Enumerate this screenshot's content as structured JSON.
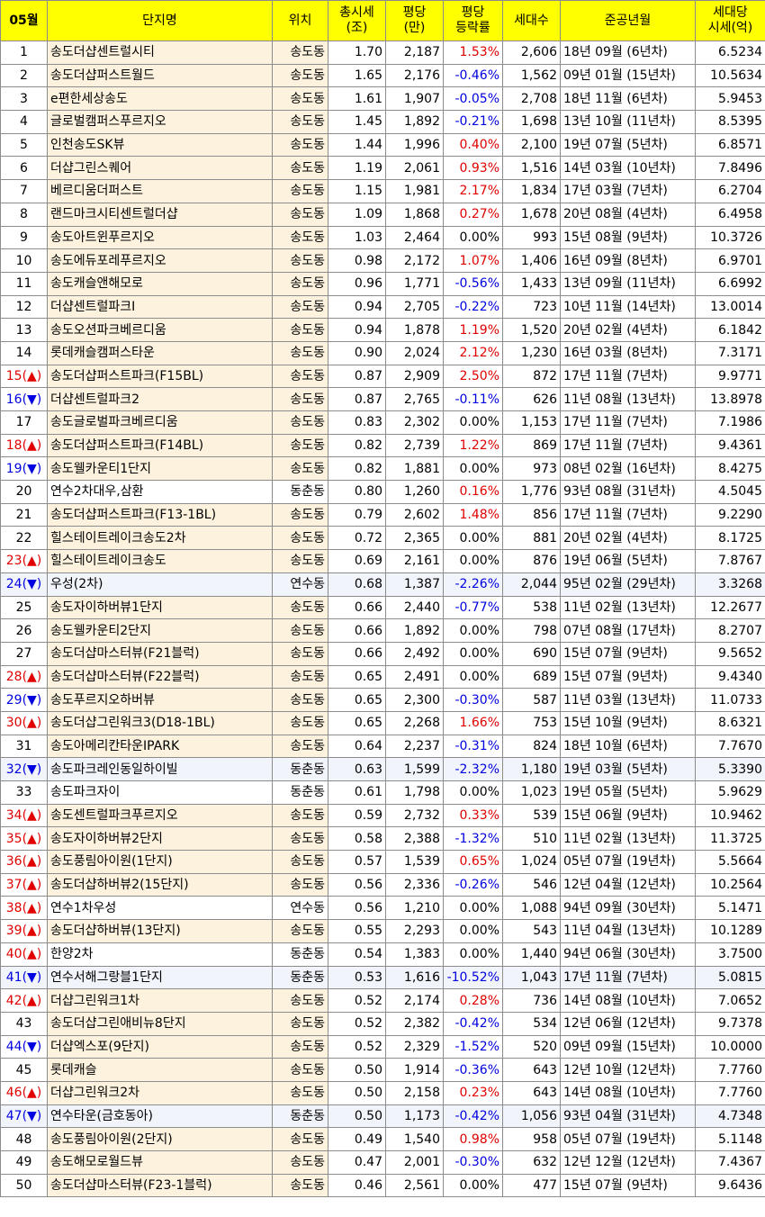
{
  "headers": {
    "month": "05월",
    "name": "단지명",
    "location": "위치",
    "total": "총시세\n(조)",
    "per_pyeong": "평당\n(만)",
    "change": "평당\n등락률",
    "households": "세대수",
    "completion": "준공년월",
    "per_household": "세대당\n시세(억)"
  },
  "colors": {
    "up": "#e00000",
    "down": "#0000e0",
    "header_bg": "#ffff00",
    "row_tint": "#fdf2dd"
  },
  "rows": [
    {
      "rank": "1",
      "name": "송도더샵센트럴시티",
      "loc": "송도동",
      "total": "1.70",
      "pp": "2,187",
      "chg": "1.53%",
      "hh": "2,606",
      "year": "18년 09월 (6년차)",
      "phh": "6.5234"
    },
    {
      "rank": "2",
      "name": "송도더샵퍼스트월드",
      "loc": "송도동",
      "total": "1.65",
      "pp": "2,176",
      "chg": "-0.46%",
      "hh": "1,562",
      "year": "09년 01월 (15년차)",
      "phh": "10.5634"
    },
    {
      "rank": "3",
      "name": "e편한세상송도",
      "loc": "송도동",
      "total": "1.61",
      "pp": "1,907",
      "chg": "-0.05%",
      "hh": "2,708",
      "year": "18년 11월 (6년차)",
      "phh": "5.9453"
    },
    {
      "rank": "4",
      "name": "글로벌캠퍼스푸르지오",
      "loc": "송도동",
      "total": "1.45",
      "pp": "1,892",
      "chg": "-0.21%",
      "hh": "1,698",
      "year": "13년 10월 (11년차)",
      "phh": "8.5395"
    },
    {
      "rank": "5",
      "name": "인천송도SK뷰",
      "loc": "송도동",
      "total": "1.44",
      "pp": "1,996",
      "chg": "0.40%",
      "hh": "2,100",
      "year": "19년 07월 (5년차)",
      "phh": "6.8571"
    },
    {
      "rank": "6",
      "name": "더샵그린스퀘어",
      "loc": "송도동",
      "total": "1.19",
      "pp": "2,061",
      "chg": "0.93%",
      "hh": "1,516",
      "year": "14년 03월 (10년차)",
      "phh": "7.8496"
    },
    {
      "rank": "7",
      "name": "베르디움더퍼스트",
      "loc": "송도동",
      "total": "1.15",
      "pp": "1,981",
      "chg": "2.17%",
      "hh": "1,834",
      "year": "17년 03월 (7년차)",
      "phh": "6.2704"
    },
    {
      "rank": "8",
      "name": "랜드마크시티센트럴더샵",
      "loc": "송도동",
      "total": "1.09",
      "pp": "1,868",
      "chg": "0.27%",
      "hh": "1,678",
      "year": "20년 08월 (4년차)",
      "phh": "6.4958"
    },
    {
      "rank": "9",
      "name": "송도아트윈푸르지오",
      "loc": "송도동",
      "total": "1.03",
      "pp": "2,464",
      "chg": "0.00%",
      "hh": "993",
      "year": "15년 08월 (9년차)",
      "phh": "10.3726"
    },
    {
      "rank": "10",
      "name": "송도에듀포레푸르지오",
      "loc": "송도동",
      "total": "0.98",
      "pp": "2,172",
      "chg": "1.07%",
      "hh": "1,406",
      "year": "16년 09월 (8년차)",
      "phh": "6.9701"
    },
    {
      "rank": "11",
      "name": "송도캐슬앤해모로",
      "loc": "송도동",
      "total": "0.96",
      "pp": "1,771",
      "chg": "-0.56%",
      "hh": "1,433",
      "year": "13년 09월 (11년차)",
      "phh": "6.6992"
    },
    {
      "rank": "12",
      "name": "더샵센트럴파크Ⅰ",
      "loc": "송도동",
      "total": "0.94",
      "pp": "2,705",
      "chg": "-0.22%",
      "hh": "723",
      "year": "10년 11월 (14년차)",
      "phh": "13.0014"
    },
    {
      "rank": "13",
      "name": "송도오션파크베르디움",
      "loc": "송도동",
      "total": "0.94",
      "pp": "1,878",
      "chg": "1.19%",
      "hh": "1,520",
      "year": "20년 02월 (4년차)",
      "phh": "6.1842"
    },
    {
      "rank": "14",
      "name": "롯데캐슬캠퍼스타운",
      "loc": "송도동",
      "total": "0.90",
      "pp": "2,024",
      "chg": "2.12%",
      "hh": "1,230",
      "year": "16년 03월 (8년차)",
      "phh": "7.3171"
    },
    {
      "rank": "15",
      "arrow": "(▲)",
      "name": "송도더샵퍼스트파크(F15BL)",
      "loc": "송도동",
      "total": "0.87",
      "pp": "2,909",
      "chg": "2.50%",
      "hh": "872",
      "year": "17년 11월 (7년차)",
      "phh": "9.9771"
    },
    {
      "rank": "16",
      "arrow": "(▼)",
      "name": "더샵센트럴파크2",
      "loc": "송도동",
      "total": "0.87",
      "pp": "2,765",
      "chg": "-0.11%",
      "hh": "626",
      "year": "11년 08월 (13년차)",
      "phh": "13.8978"
    },
    {
      "rank": "17",
      "name": "송도글로벌파크베르디움",
      "loc": "송도동",
      "total": "0.83",
      "pp": "2,302",
      "chg": "0.00%",
      "hh": "1,153",
      "year": "17년 11월 (7년차)",
      "phh": "7.1986"
    },
    {
      "rank": "18",
      "arrow": "(▲)",
      "name": "송도더샵퍼스트파크(F14BL)",
      "loc": "송도동",
      "total": "0.82",
      "pp": "2,739",
      "chg": "1.22%",
      "hh": "869",
      "year": "17년 11월 (7년차)",
      "phh": "9.4361"
    },
    {
      "rank": "19",
      "arrow": "(▼)",
      "name": "송도웰카운티1단지",
      "loc": "송도동",
      "total": "0.82",
      "pp": "1,881",
      "chg": "0.00%",
      "hh": "973",
      "year": "08년 02월 (16년차)",
      "phh": "8.4275"
    },
    {
      "rank": "20",
      "name": "연수2차대우,삼환",
      "loc": "동춘동",
      "total": "0.80",
      "pp": "1,260",
      "chg": "0.16%",
      "hh": "1,776",
      "year": "93년 08월 (31년차)",
      "phh": "4.5045"
    },
    {
      "rank": "21",
      "name": "송도더샵퍼스트파크(F13-1BL)",
      "loc": "송도동",
      "total": "0.79",
      "pp": "2,602",
      "chg": "1.48%",
      "hh": "856",
      "year": "17년 11월 (7년차)",
      "phh": "9.2290"
    },
    {
      "rank": "22",
      "name": "힐스테이트레이크송도2차",
      "loc": "송도동",
      "total": "0.72",
      "pp": "2,365",
      "chg": "0.00%",
      "hh": "881",
      "year": "20년 02월 (4년차)",
      "phh": "8.1725"
    },
    {
      "rank": "23",
      "arrow": "(▲)",
      "name": "힐스테이트레이크송도",
      "loc": "송도동",
      "total": "0.69",
      "pp": "2,161",
      "chg": "0.00%",
      "hh": "876",
      "year": "19년 06월 (5년차)",
      "phh": "7.8767"
    },
    {
      "rank": "24",
      "arrow": "(▼)",
      "name": "우성(2차)",
      "loc": "연수동",
      "total": "0.68",
      "pp": "1,387",
      "chg": "-2.26%",
      "hh": "2,044",
      "year": "95년 02월 (29년차)",
      "phh": "3.3268"
    },
    {
      "rank": "25",
      "name": "송도자이하버뷰1단지",
      "loc": "송도동",
      "total": "0.66",
      "pp": "2,440",
      "chg": "-0.77%",
      "hh": "538",
      "year": "11년 02월 (13년차)",
      "phh": "12.2677"
    },
    {
      "rank": "26",
      "name": "송도웰카운티2단지",
      "loc": "송도동",
      "total": "0.66",
      "pp": "1,892",
      "chg": "0.00%",
      "hh": "798",
      "year": "07년 08월 (17년차)",
      "phh": "8.2707"
    },
    {
      "rank": "27",
      "name": "송도더샵마스터뷰(F21블럭)",
      "loc": "송도동",
      "total": "0.66",
      "pp": "2,492",
      "chg": "0.00%",
      "hh": "690",
      "year": "15년 07월 (9년차)",
      "phh": "9.5652"
    },
    {
      "rank": "28",
      "arrow": "(▲)",
      "name": "송도더샵마스터뷰(F22블럭)",
      "loc": "송도동",
      "total": "0.65",
      "pp": "2,491",
      "chg": "0.00%",
      "hh": "689",
      "year": "15년 07월 (9년차)",
      "phh": "9.4340"
    },
    {
      "rank": "29",
      "arrow": "(▼)",
      "name": "송도푸르지오하버뷰",
      "loc": "송도동",
      "total": "0.65",
      "pp": "2,300",
      "chg": "-0.30%",
      "hh": "587",
      "year": "11년 03월 (13년차)",
      "phh": "11.0733"
    },
    {
      "rank": "30",
      "arrow": "(▲)",
      "name": "송도더샵그린워크3(D18-1BL)",
      "loc": "송도동",
      "total": "0.65",
      "pp": "2,268",
      "chg": "1.66%",
      "hh": "753",
      "year": "15년 10월 (9년차)",
      "phh": "8.6321"
    },
    {
      "rank": "31",
      "name": "송도아메리칸타운IPARK",
      "loc": "송도동",
      "total": "0.64",
      "pp": "2,237",
      "chg": "-0.31%",
      "hh": "824",
      "year": "18년 10월 (6년차)",
      "phh": "7.7670"
    },
    {
      "rank": "32",
      "arrow": "(▼)",
      "name": "송도파크레인동일하이빌",
      "loc": "동춘동",
      "total": "0.63",
      "pp": "1,599",
      "chg": "-2.32%",
      "hh": "1,180",
      "year": "19년 03월 (5년차)",
      "phh": "5.3390"
    },
    {
      "rank": "33",
      "name": "송도파크자이",
      "loc": "동춘동",
      "total": "0.61",
      "pp": "1,798",
      "chg": "0.00%",
      "hh": "1,023",
      "year": "19년 05월 (5년차)",
      "phh": "5.9629"
    },
    {
      "rank": "34",
      "arrow": "(▲)",
      "name": "송도센트럴파크푸르지오",
      "loc": "송도동",
      "total": "0.59",
      "pp": "2,732",
      "chg": "0.33%",
      "hh": "539",
      "year": "15년 06월 (9년차)",
      "phh": "10.9462"
    },
    {
      "rank": "35",
      "arrow": "(▲)",
      "name": "송도자이하버뷰2단지",
      "loc": "송도동",
      "total": "0.58",
      "pp": "2,388",
      "chg": "-1.32%",
      "hh": "510",
      "year": "11년 02월 (13년차)",
      "phh": "11.3725"
    },
    {
      "rank": "36",
      "arrow": "(▲)",
      "name": "송도풍림아이원(1단지)",
      "loc": "송도동",
      "total": "0.57",
      "pp": "1,539",
      "chg": "0.65%",
      "hh": "1,024",
      "year": "05년 07월 (19년차)",
      "phh": "5.5664"
    },
    {
      "rank": "37",
      "arrow": "(▲)",
      "name": "송도더샵하버뷰2(15단지)",
      "loc": "송도동",
      "total": "0.56",
      "pp": "2,336",
      "chg": "-0.26%",
      "hh": "546",
      "year": "12년 04월 (12년차)",
      "phh": "10.2564"
    },
    {
      "rank": "38",
      "arrow": "(▲)",
      "name": "연수1차우성",
      "loc": "연수동",
      "total": "0.56",
      "pp": "1,210",
      "chg": "0.00%",
      "hh": "1,088",
      "year": "94년 09월 (30년차)",
      "phh": "5.1471"
    },
    {
      "rank": "39",
      "arrow": "(▲)",
      "name": "송도더샵하버뷰(13단지)",
      "loc": "송도동",
      "total": "0.55",
      "pp": "2,293",
      "chg": "0.00%",
      "hh": "543",
      "year": "11년 04월 (13년차)",
      "phh": "10.1289"
    },
    {
      "rank": "40",
      "arrow": "(▲)",
      "name": "한양2차",
      "loc": "동춘동",
      "total": "0.54",
      "pp": "1,383",
      "chg": "0.00%",
      "hh": "1,440",
      "year": "94년 06월 (30년차)",
      "phh": "3.7500"
    },
    {
      "rank": "41",
      "arrow": "(▼)",
      "name": "연수서해그랑블1단지",
      "loc": "동춘동",
      "total": "0.53",
      "pp": "1,616",
      "chg": "-10.52%",
      "hh": "1,043",
      "year": "17년 11월 (7년차)",
      "phh": "5.0815"
    },
    {
      "rank": "42",
      "arrow": "(▲)",
      "name": "더샵그린워크1차",
      "loc": "송도동",
      "total": "0.52",
      "pp": "2,174",
      "chg": "0.28%",
      "hh": "736",
      "year": "14년 08월 (10년차)",
      "phh": "7.0652"
    },
    {
      "rank": "43",
      "name": "송도더샵그린애비뉴8단지",
      "loc": "송도동",
      "total": "0.52",
      "pp": "2,382",
      "chg": "-0.42%",
      "hh": "534",
      "year": "12년 06월 (12년차)",
      "phh": "9.7378"
    },
    {
      "rank": "44",
      "arrow": "(▼)",
      "name": "더샵엑스포(9단지)",
      "loc": "송도동",
      "total": "0.52",
      "pp": "2,329",
      "chg": "-1.52%",
      "hh": "520",
      "year": "09년 09월 (15년차)",
      "phh": "10.0000"
    },
    {
      "rank": "45",
      "name": "롯데캐슬",
      "loc": "송도동",
      "total": "0.50",
      "pp": "1,914",
      "chg": "-0.36%",
      "hh": "643",
      "year": "12년 10월 (12년차)",
      "phh": "7.7760"
    },
    {
      "rank": "46",
      "arrow": "(▲)",
      "name": "더샵그린워크2차",
      "loc": "송도동",
      "total": "0.50",
      "pp": "2,158",
      "chg": "0.23%",
      "hh": "643",
      "year": "14년 08월 (10년차)",
      "phh": "7.7760"
    },
    {
      "rank": "47",
      "arrow": "(▼)",
      "name": "연수타운(금호동아)",
      "loc": "동춘동",
      "total": "0.50",
      "pp": "1,173",
      "chg": "-0.42%",
      "hh": "1,056",
      "year": "93년 04월 (31년차)",
      "phh": "4.7348"
    },
    {
      "rank": "48",
      "name": "송도풍림아이원(2단지)",
      "loc": "송도동",
      "total": "0.49",
      "pp": "1,540",
      "chg": "0.98%",
      "hh": "958",
      "year": "05년 07월 (19년차)",
      "phh": "5.1148"
    },
    {
      "rank": "49",
      "name": "송도해모로월드뷰",
      "loc": "송도동",
      "total": "0.47",
      "pp": "2,001",
      "chg": "-0.30%",
      "hh": "632",
      "year": "12년 12월 (12년차)",
      "phh": "7.4367"
    },
    {
      "rank": "50",
      "name": "송도더샵마스터뷰(F23-1블럭)",
      "loc": "송도동",
      "total": "0.46",
      "pp": "2,561",
      "chg": "0.00%",
      "hh": "477",
      "year": "15년 07월 (9년차)",
      "phh": "9.6436"
    }
  ]
}
